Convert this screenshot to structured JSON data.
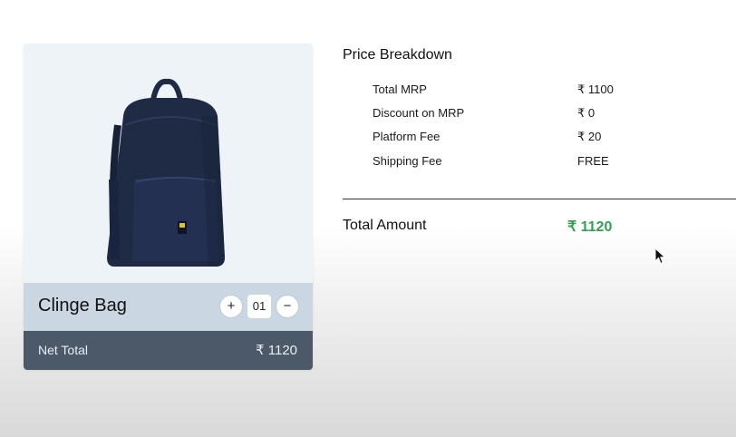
{
  "product": {
    "name": "Clinge Bag",
    "quantity": "01",
    "plus_label": "+",
    "minus_label": "−",
    "net_total_label": "Net Total",
    "net_total_value": "₹ 1120"
  },
  "breakdown": {
    "title": "Price Breakdown",
    "rows": [
      {
        "label": "Total MRP",
        "value": "₹ 1100"
      },
      {
        "label": "Discount on MRP",
        "value": "₹ 0"
      },
      {
        "label": "Platform Fee",
        "value": "₹ 20"
      },
      {
        "label": "Shipping Fee",
        "value": "FREE"
      }
    ],
    "total_label": "Total Amount",
    "total_value": "₹ 1120"
  },
  "colors": {
    "accent_green": "#2ea44f",
    "net_bar": "#4b5968",
    "info_bar": "#cad7e2",
    "bag": "#1f2a44"
  },
  "icons": {
    "product_image": "backpack-image",
    "cursor": "mouse-pointer-icon"
  }
}
